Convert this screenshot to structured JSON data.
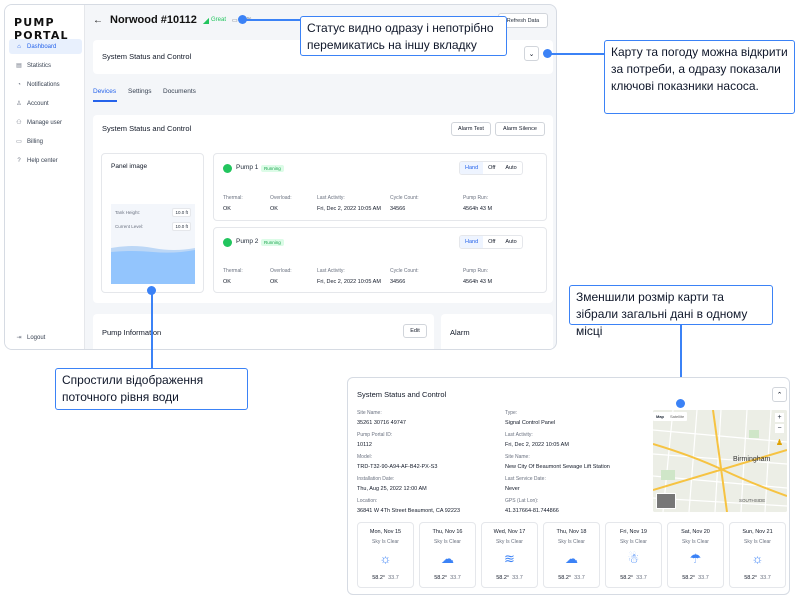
{
  "sidebar": {
    "logo": "PUMP PORTAL",
    "items": [
      {
        "label": "Dashboard",
        "icon": "home-icon",
        "active": true
      },
      {
        "label": "Statistics",
        "icon": "chart-icon"
      },
      {
        "label": "Notifications",
        "icon": "bell-icon"
      },
      {
        "label": "Account",
        "icon": "user-icon"
      },
      {
        "label": "Manage user",
        "icon": "users-icon"
      },
      {
        "label": "Billing",
        "icon": "card-icon"
      },
      {
        "label": "Help center",
        "icon": "help-icon"
      }
    ],
    "logout": "Logout"
  },
  "header": {
    "title": "Norwood #10112",
    "status": "Great",
    "battery_pct": "68%",
    "refresh": "Refresh Data"
  },
  "system_bar": {
    "title": "System Status and Control"
  },
  "tabs": [
    "Devices",
    "Settings",
    "Documents"
  ],
  "control_card": {
    "title": "System Status and Control",
    "alarm_test": "Alarm Test",
    "alarm_silence": "Alarm Silence"
  },
  "panel_image": {
    "title": "Panel image",
    "tank_height_label": "Tank Height:",
    "tank_height_val": "10.0 ft",
    "current_level_label": "Current Level:",
    "current_level_val": "10.0 ft"
  },
  "pumps": [
    {
      "name": "Pump 1",
      "status": "Running",
      "modes": [
        "Hand",
        "Off",
        "Auto"
      ],
      "fields": [
        [
          "Thermal:",
          "OK"
        ],
        [
          "Overload:",
          "OK"
        ],
        [
          "Last Activity:",
          "Fri, Dec 2, 2022 10:05 AM"
        ],
        [
          "Cycle Count:",
          "34566"
        ],
        [
          "Pump Run:",
          "4564h 43 M"
        ]
      ]
    },
    {
      "name": "Pump 2",
      "status": "Running",
      "modes": [
        "Hand",
        "Off",
        "Auto"
      ],
      "fields": [
        [
          "Thermal:",
          "OK"
        ],
        [
          "Overload:",
          "OK"
        ],
        [
          "Last Activity:",
          "Fri, Dec 2, 2022 10:05 AM"
        ],
        [
          "Cycle Count:",
          "34566"
        ],
        [
          "Pump Run:",
          "4564h 43 M"
        ]
      ]
    }
  ],
  "pump_info": {
    "title": "Pump Information",
    "edit": "Edit"
  },
  "alarm": {
    "title": "Alarm"
  },
  "callouts": {
    "status": "Статус видно одразу і непотрібно перемикатись на іншу вкладку",
    "map": "Карту та погоду можна відкрити за потреби, а одразу показали ключові показники насоса.",
    "water": "Спростили відображення поточного рівня води",
    "summary": "Зменшили розмір карти та зібрали загальні дані в одному місці"
  },
  "detail": {
    "title": "System Status and Control",
    "left": [
      [
        "Site Name:",
        "35261 30716 49747"
      ],
      [
        "Pump Portal ID:",
        "10112"
      ],
      [
        "Model:",
        "TRD-T32-90-A94-AF-B42-PX-S3"
      ],
      [
        "Installation Date:",
        "Thu, Aug 25, 2022 12:00 AM"
      ],
      [
        "Location:",
        "36841 W 4Th Street Beaumont, CA 92223"
      ]
    ],
    "right": [
      [
        "Type:",
        "Signal Control Panel"
      ],
      [
        "Last Activity:",
        "Fri, Dec 2, 2022 10:05 AM"
      ],
      [
        "Site Name:",
        "New City Of Beaumont Sewage Lift Station"
      ],
      [
        "Last Service Date:",
        "Never"
      ],
      [
        "GPS (Lat Lon):",
        "41.317664-81.744866"
      ]
    ],
    "map": {
      "tab_map": "Map",
      "tab_sat": "Satellite",
      "city": "Birmingham",
      "district": "SOUTHSIDE"
    },
    "weather": [
      {
        "day": "Mon, Nov 15",
        "sky": "Sky Is Clear",
        "icon": "sun-icon",
        "glyph": "☼",
        "hi": "58.2°",
        "lo": "33.7"
      },
      {
        "day": "Thu, Nov 16",
        "sky": "Sky Is Clear",
        "icon": "cloud-sun-icon",
        "glyph": "☁",
        "hi": "58.2°",
        "lo": "33.7"
      },
      {
        "day": "Wed, Nov 17",
        "sky": "Sky Is Clear",
        "icon": "wind-icon",
        "glyph": "≋",
        "hi": "58.2°",
        "lo": "33.7"
      },
      {
        "day": "Thu, Nov 18",
        "sky": "Sky Is Clear",
        "icon": "cloud-icon",
        "glyph": "☁",
        "hi": "58.2°",
        "lo": "33.7"
      },
      {
        "day": "Fri, Nov 19",
        "sky": "Sky Is Clear",
        "icon": "snow-cloud-icon",
        "glyph": "☃",
        "hi": "58.2°",
        "lo": "33.7"
      },
      {
        "day": "Sat, Nov 20",
        "sky": "Sky Is Clear",
        "icon": "rain-cloud-icon",
        "glyph": "☂",
        "hi": "58.2°",
        "lo": "33.7"
      },
      {
        "day": "Sun, Nov 21",
        "sky": "Sky Is Clear",
        "icon": "sun-icon",
        "glyph": "☼",
        "hi": "58.2°",
        "lo": "33.7"
      }
    ]
  },
  "colors": {
    "accent": "#2563eb",
    "callout": "#3b82f6",
    "good": "#22c55e",
    "water": "#93c5fd"
  }
}
